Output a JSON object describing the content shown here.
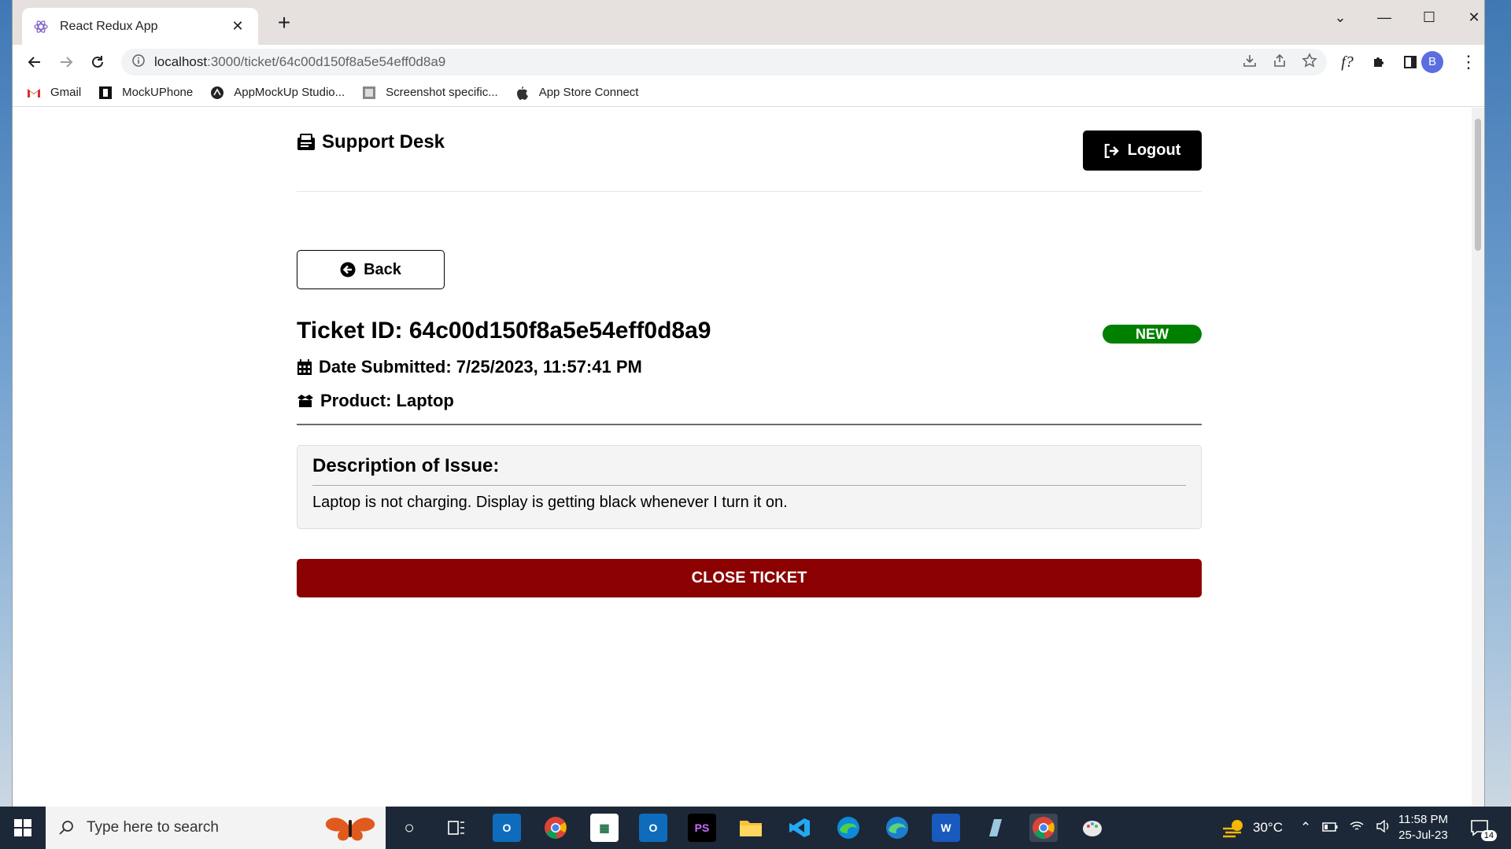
{
  "browser": {
    "tab_title": "React Redux App",
    "url_host": "localhost",
    "url_path": ":3000/ticket/64c00d150f8a5e54eff0d8a9",
    "profile_initial": "B",
    "bookmarks": [
      {
        "label": "Gmail",
        "icon": "gmail-icon"
      },
      {
        "label": "MockUPhone",
        "icon": "mockuphone-icon"
      },
      {
        "label": "AppMockUp Studio...",
        "icon": "appmockup-icon"
      },
      {
        "label": "Screenshot specific...",
        "icon": "screenshot-icon"
      },
      {
        "label": "App Store Connect",
        "icon": "apple-icon"
      }
    ]
  },
  "header": {
    "logo_text": "Support Desk",
    "logout_label": "Logout"
  },
  "ticket": {
    "back_label": "Back",
    "id_text": "Ticket ID: 64c00d150f8a5e54eff0d8a9",
    "status": "NEW",
    "date_text": "Date Submitted: 7/25/2023, 11:57:41 PM",
    "product_text": "Product: Laptop",
    "description_title": "Description of Issue:",
    "description": "Laptop is not charging. Display is getting black whenever I turn it on.",
    "close_label": "CLOSE TICKET"
  },
  "taskbar": {
    "search_placeholder": "Type here to search",
    "weather": "30°C",
    "time": "11:58 PM",
    "date": "25-Jul-23",
    "notifications": "14"
  },
  "colors": {
    "status_new": "#008000",
    "close_button": "#8b0000",
    "logout_button": "#000000"
  }
}
